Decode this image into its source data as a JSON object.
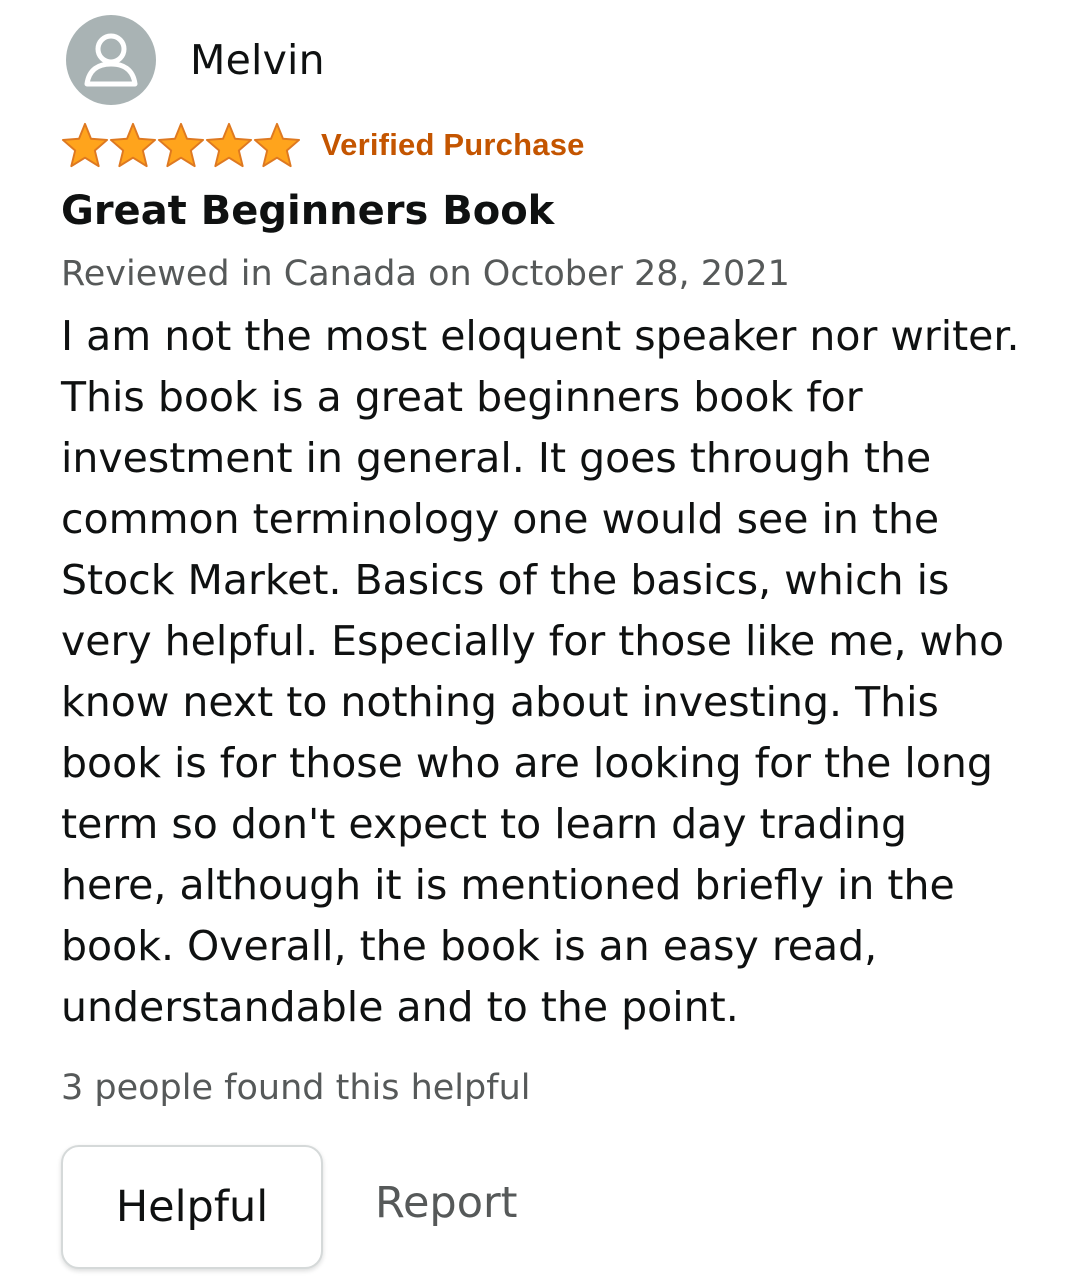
{
  "reviewer": {
    "name": "Melvin",
    "avatar_icon": "person-icon",
    "avatar_color": "#a9b3b4"
  },
  "rating": {
    "stars": 5,
    "max_stars": 5,
    "star_color": "#ffa41c",
    "badge_text": "Verified Purchase",
    "badge_color": "#c45500"
  },
  "review": {
    "title": "Great Beginners Book",
    "date_text": "Reviewed in Canada on October 28, 2021",
    "body": "I am not the most eloquent speaker nor writer. This book is a great beginners book for investment in general. It goes through the common terminology one would see in the Stock Market. Basics of the basics, which is very helpful. Especially for those like me, who know next to nothing about investing. This book is for those who are looking for the long term so don't expect to learn day trading here, although it is mentioned briefly in the book. Overall, the book is an easy read, understandable and to the point."
  },
  "feedback": {
    "helpful_count_text": "3 people found this helpful",
    "helpful_button_label": "Helpful",
    "report_label": "Report"
  }
}
